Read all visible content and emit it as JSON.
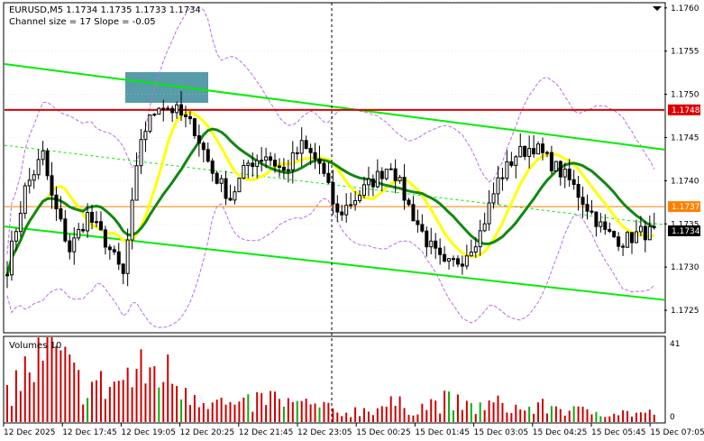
{
  "header": {
    "symbol_line": "EURUSD,M5  1.1734 1.1735 1.1733 1.1734",
    "channel_line": "Channel size = 17 Slope = -0.05"
  },
  "volume_panel": {
    "title": "Volumes 10",
    "max_label": "41",
    "min_label": "0"
  },
  "colors": {
    "candle": "#000000",
    "channel": "#00ee00",
    "ma_fast": "#ffff00",
    "ma_slow": "#118811",
    "bands": "#b96fe0",
    "resistance": "#dd0000",
    "support": "#ff8000",
    "volume": "#cc0000",
    "volume_green": "#11aa11",
    "zone": "#3b8a9a"
  },
  "chart_data": {
    "type": "candlestick",
    "ylim": [
      1.17225,
      1.17605
    ],
    "y_ticks": [
      "1.1760",
      "1.1755",
      "1.1750",
      "1.1745",
      "1.1740",
      "1.1735",
      "1.1730",
      "1.1725"
    ],
    "x_tick_labels": [
      "12 Dec 2025",
      "12 Dec 17:45",
      "12 Dec 19:05",
      "12 Dec 20:25",
      "12 Dec 21:45",
      "12 Dec 23:05",
      "15 Dec 00:25",
      "15 Dec 01:45",
      "15 Dec 03:05",
      "15 Dec 04:25",
      "15 Dec 05:45",
      "15 Dec 07:05"
    ],
    "levels": [
      {
        "label": "1.1748",
        "price": 1.17482,
        "color": "#dd0000"
      },
      {
        "label": "1.1737",
        "price": 1.1737,
        "color": "#ff8000"
      },
      {
        "label": "1.1734",
        "price": 1.17342,
        "color": "#000000"
      }
    ],
    "channel": {
      "upper": [
        1.17535,
        1.17436
      ],
      "lower": [
        1.17347,
        1.17262
      ]
    },
    "bars": 146,
    "close_anchors": [
      [
        0,
        1.173
      ],
      [
        4,
        1.1739
      ],
      [
        8,
        1.1743
      ],
      [
        10,
        1.1738
      ],
      [
        14,
        1.1732
      ],
      [
        18,
        1.1736
      ],
      [
        22,
        1.1733
      ],
      [
        26,
        1.1729
      ],
      [
        30,
        1.1745
      ],
      [
        34,
        1.1749
      ],
      [
        38,
        1.1748
      ],
      [
        42,
        1.1746
      ],
      [
        46,
        1.1741
      ],
      [
        50,
        1.1738
      ],
      [
        54,
        1.1742
      ],
      [
        58,
        1.1743
      ],
      [
        62,
        1.1741
      ],
      [
        66,
        1.1744
      ],
      [
        70,
        1.1742
      ],
      [
        74,
        1.1736
      ],
      [
        78,
        1.1738
      ],
      [
        82,
        1.174
      ],
      [
        86,
        1.1742
      ],
      [
        90,
        1.1737
      ],
      [
        94,
        1.1733
      ],
      [
        98,
        1.173
      ],
      [
        102,
        1.1731
      ],
      [
        106,
        1.1734
      ],
      [
        110,
        1.174
      ],
      [
        114,
        1.1743
      ],
      [
        118,
        1.1744
      ],
      [
        122,
        1.1742
      ],
      [
        126,
        1.174
      ],
      [
        130,
        1.1737
      ],
      [
        134,
        1.1734
      ],
      [
        138,
        1.1733
      ],
      [
        142,
        1.1734
      ],
      [
        145,
        1.1734
      ]
    ],
    "volume_anchors": [
      [
        0,
        18
      ],
      [
        6,
        32
      ],
      [
        10,
        38
      ],
      [
        16,
        22
      ],
      [
        22,
        20
      ],
      [
        28,
        26
      ],
      [
        34,
        30
      ],
      [
        40,
        20
      ],
      [
        46,
        12
      ],
      [
        52,
        8
      ],
      [
        58,
        14
      ],
      [
        64,
        10
      ],
      [
        70,
        9
      ],
      [
        74,
        5
      ],
      [
        80,
        7
      ],
      [
        86,
        10
      ],
      [
        92,
        8
      ],
      [
        98,
        12
      ],
      [
        104,
        8
      ],
      [
        110,
        10
      ],
      [
        116,
        7
      ],
      [
        122,
        9
      ],
      [
        128,
        6
      ],
      [
        134,
        6
      ],
      [
        140,
        5
      ],
      [
        145,
        5
      ]
    ],
    "vol_max": 41
  }
}
